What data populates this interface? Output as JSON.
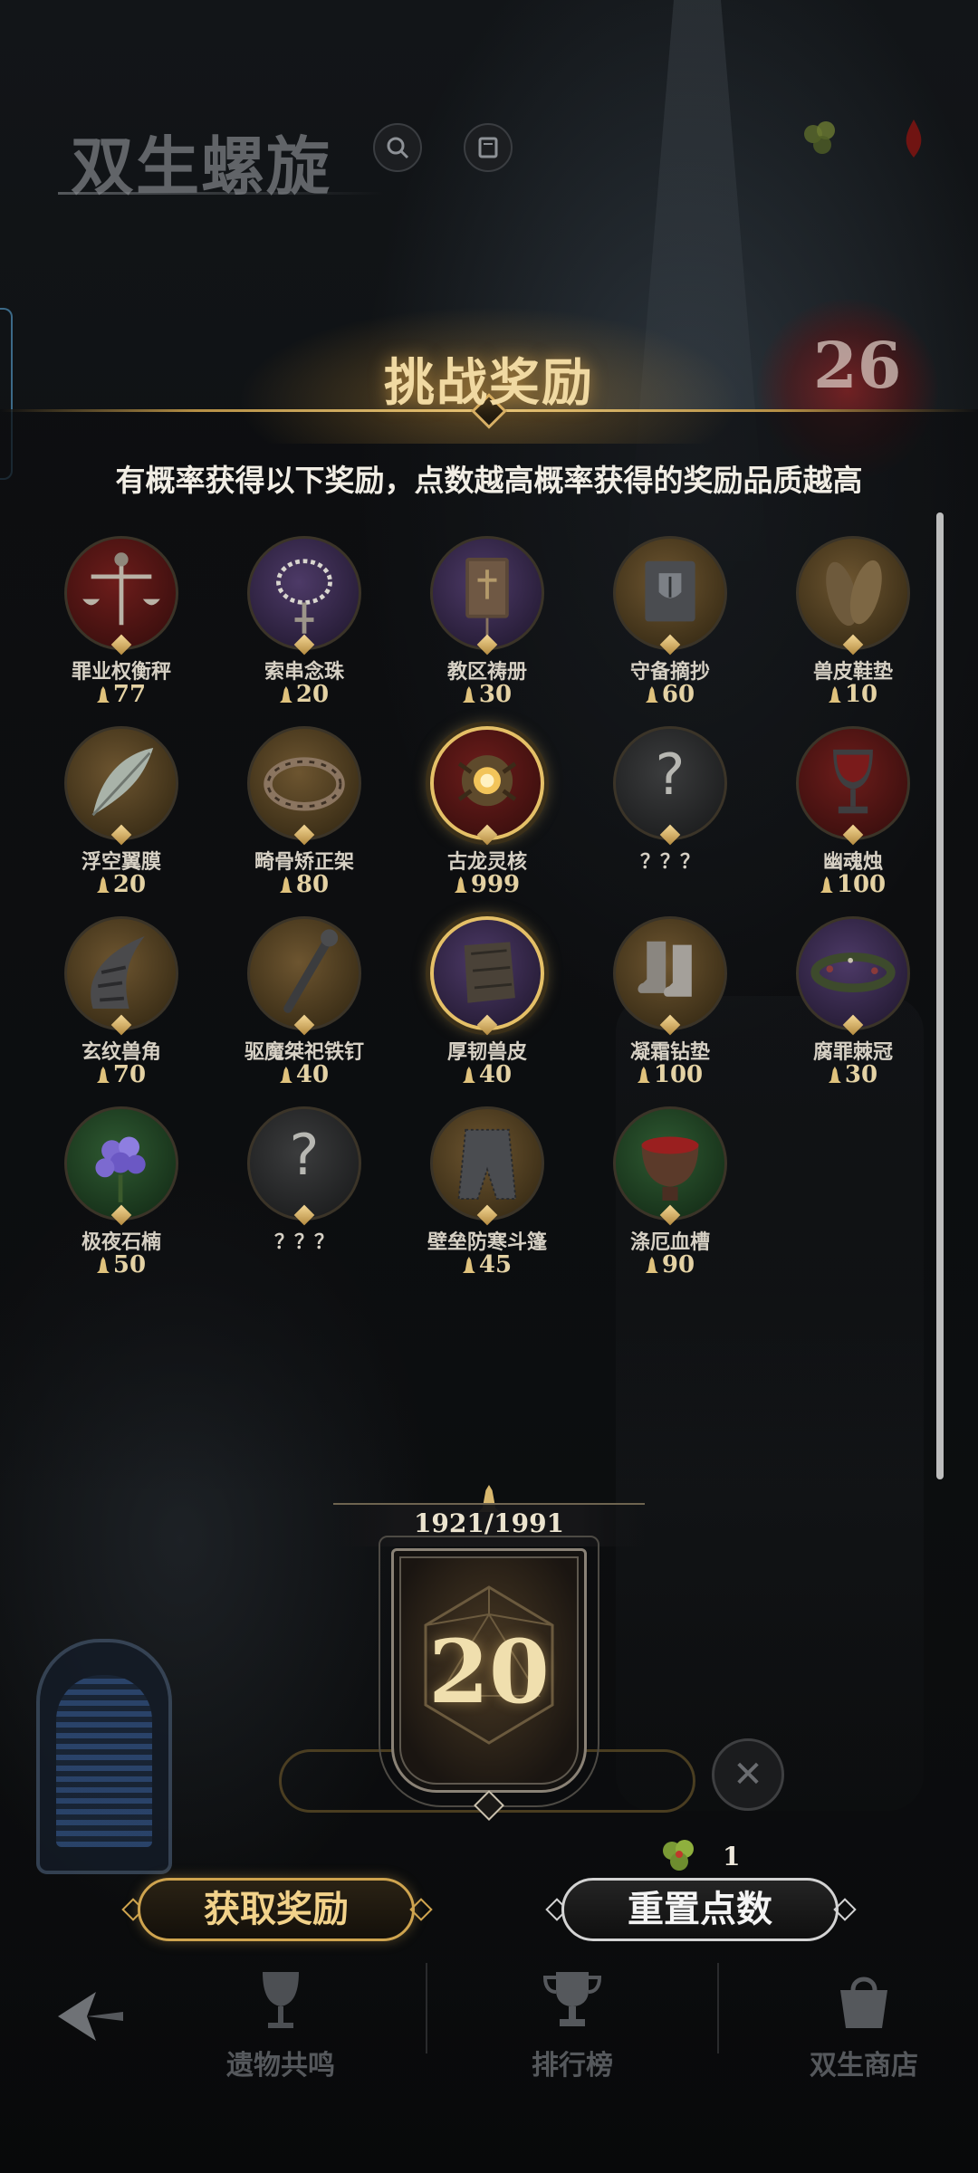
{
  "header": {
    "game_title": "双生螺旋",
    "search_icon": "search-icon",
    "menu_icon": "book-icon",
    "resources": [
      {
        "icon": "clover-icon",
        "label": "?"
      },
      {
        "icon": "blood-drop-icon",
        "label": "?"
      }
    ]
  },
  "level_badge": {
    "value": "26",
    "sub": ""
  },
  "panel": {
    "title": "挑战奖励",
    "description": "有概率获得以下奖励，点数越高概率获得的奖励品质越高"
  },
  "rewards": [
    {
      "name": "罪业权衡秤",
      "cost": "77",
      "icon": "scales-icon",
      "frame": "red"
    },
    {
      "name": "索串念珠",
      "cost": "20",
      "icon": "rosary-icon",
      "frame": "purple"
    },
    {
      "name": "教区祷册",
      "cost": "30",
      "icon": "prayer-book-icon",
      "frame": "purple"
    },
    {
      "name": "守备摘抄",
      "cost": "60",
      "icon": "shield-book-icon",
      "frame": "gold"
    },
    {
      "name": "兽皮鞋垫",
      "cost": "10",
      "icon": "insole-icon",
      "frame": "gold"
    },
    {
      "name": "浮空翼膜",
      "cost": "20",
      "icon": "wing-icon",
      "frame": "gold"
    },
    {
      "name": "畸骨矫正架",
      "cost": "80",
      "icon": "bone-brace-icon",
      "frame": "gold"
    },
    {
      "name": "古龙灵核",
      "cost": "999",
      "icon": "dragon-core-icon",
      "frame": "red",
      "highlight": true
    },
    {
      "name": "？？？",
      "cost": "",
      "icon": "unknown-icon",
      "frame": "grey"
    },
    {
      "name": "幽魂烛",
      "cost": "100",
      "icon": "chalice-icon",
      "frame": "red"
    },
    {
      "name": "玄纹兽角",
      "cost": "70",
      "icon": "horn-icon",
      "frame": "gold"
    },
    {
      "name": "驱魔桀祀铁钉",
      "cost": "40",
      "icon": "iron-nail-icon",
      "frame": "gold"
    },
    {
      "name": "厚韧兽皮",
      "cost": "40",
      "icon": "hide-icon",
      "frame": "purple",
      "highlight": true
    },
    {
      "name": "凝霜钻垫",
      "cost": "100",
      "icon": "boots-icon",
      "frame": "gold"
    },
    {
      "name": "腐罪棘冠",
      "cost": "30",
      "icon": "thorn-crown-icon",
      "frame": "purple"
    },
    {
      "name": "极夜石楠",
      "cost": "50",
      "icon": "heather-icon",
      "frame": "green"
    },
    {
      "name": "？？？",
      "cost": "",
      "icon": "unknown-icon",
      "frame": "grey"
    },
    {
      "name": "壁垒防寒斗篷",
      "cost": "45",
      "icon": "chainmail-icon",
      "frame": "gold"
    },
    {
      "name": "涤厄血槽",
      "cost": "90",
      "icon": "blood-basin-icon",
      "frame": "green"
    }
  ],
  "dice": {
    "count": "1921/1991",
    "value": "20",
    "icon": "d20-icon"
  },
  "clover": {
    "icon": "clover-icon",
    "count": "1"
  },
  "buttons": {
    "claim": "获取奖励",
    "reset": "重置点数"
  },
  "nav": {
    "back_icon": "back-arrow-icon",
    "items": [
      {
        "label": "遗物共鸣",
        "icon": "goblet-icon"
      },
      {
        "label": "排行榜",
        "icon": "trophy-icon"
      },
      {
        "label": "双生商店",
        "icon": "shop-bag-icon"
      }
    ]
  },
  "colors": {
    "accent_gold": "#e5c067",
    "panel_line": "#b58f45",
    "text_light": "#f1ede4"
  }
}
